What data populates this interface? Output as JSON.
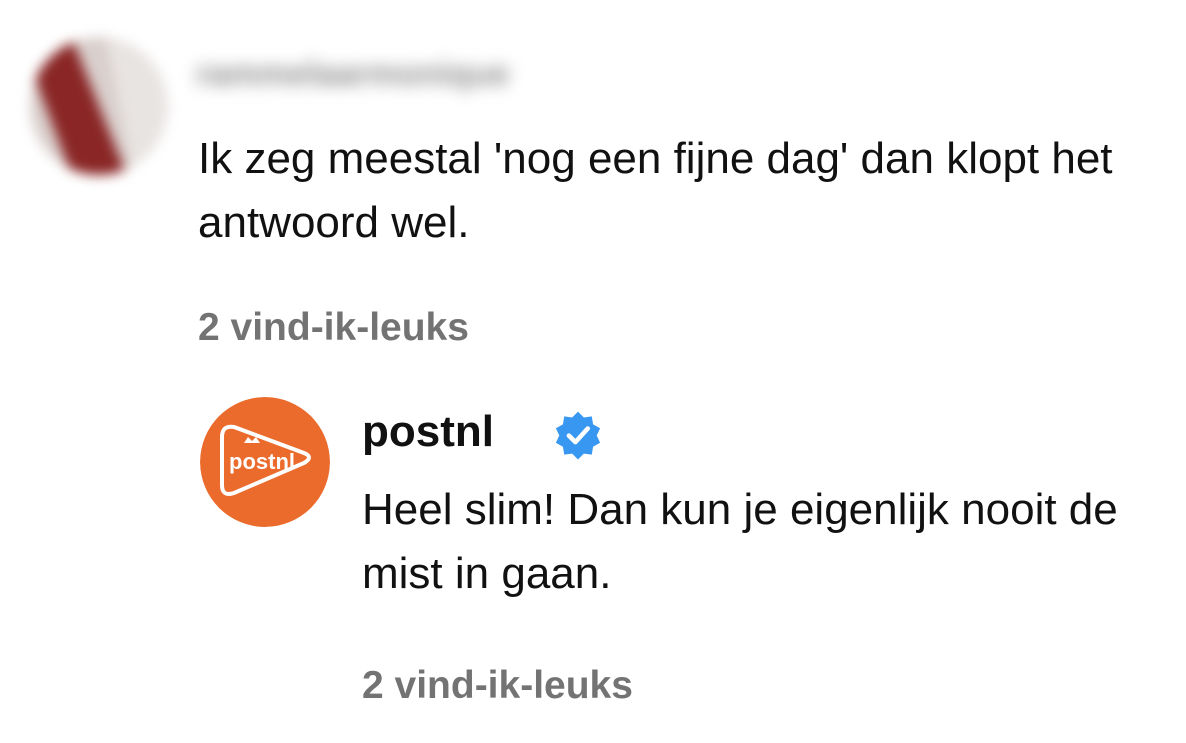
{
  "comments": [
    {
      "username": "rammelaarmonique",
      "username_blurred": true,
      "avatar_icon": "user-avatar-blurred",
      "text": "Ik zeg meestal 'nog een fijne dag' dan klopt het antwoord wel.",
      "likes": "2 vind-ik-leuks"
    },
    {
      "username": "postnl",
      "verified": true,
      "avatar_icon": "postnl-logo",
      "avatar_label": "postnl",
      "text": "Heel slim! Dan kun je eigenlijk nooit de mist in gaan.",
      "likes": "2 vind-ik-leuks"
    }
  ],
  "colors": {
    "brand_orange": "#EB6B2C",
    "verified_blue": "#3897F0",
    "muted_text": "#737373"
  }
}
